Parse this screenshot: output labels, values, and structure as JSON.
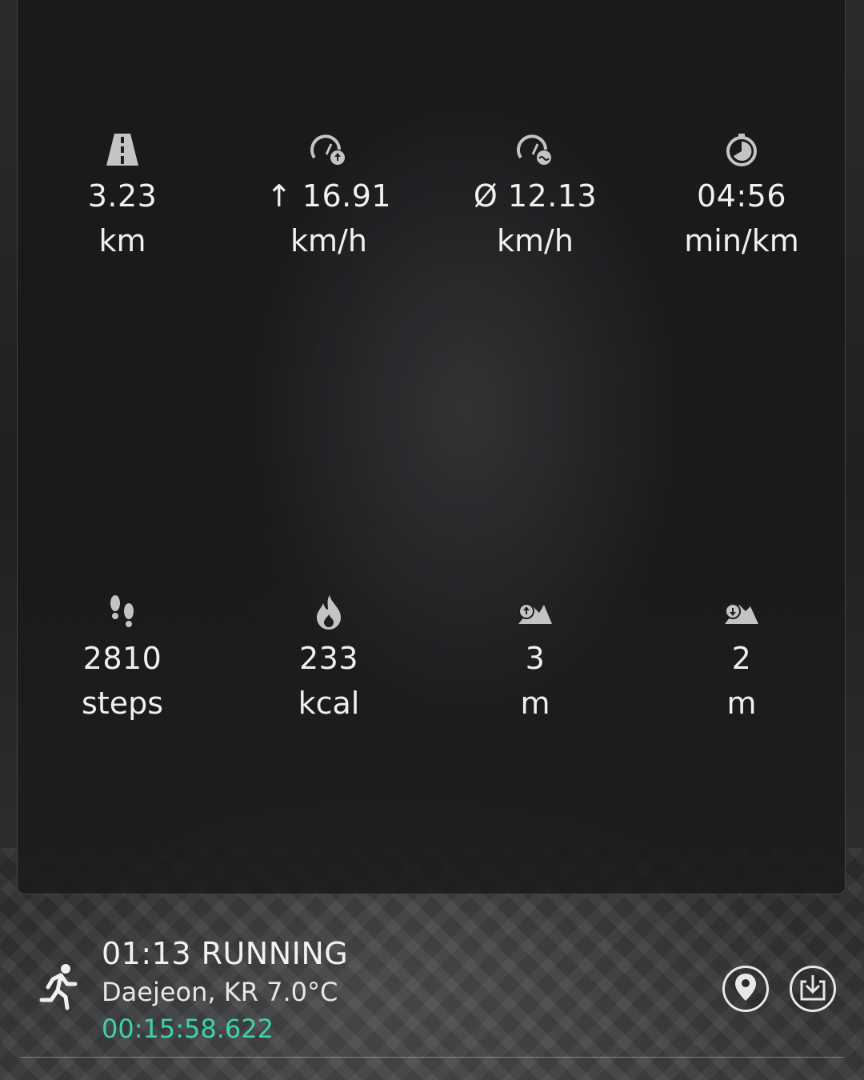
{
  "stats_top": [
    {
      "icon": "road-icon",
      "value": "3.23",
      "unit": "km"
    },
    {
      "icon": "max-speed-icon",
      "value": "↑ 16.91",
      "unit": "km/h"
    },
    {
      "icon": "avg-speed-icon",
      "value": "Ø 12.13",
      "unit": "km/h"
    },
    {
      "icon": "pace-timer-icon",
      "value": "04:56",
      "unit": "min/km"
    }
  ],
  "stats_bottom": [
    {
      "icon": "footsteps-icon",
      "value": "2810",
      "unit": "steps"
    },
    {
      "icon": "flame-icon",
      "value": "233",
      "unit": "kcal"
    },
    {
      "icon": "elevation-up-icon",
      "value": "3",
      "unit": "m"
    },
    {
      "icon": "elevation-down-icon",
      "value": "2",
      "unit": "m"
    }
  ],
  "activity": {
    "title": "01:13 RUNNING",
    "location": "Daejeon, KR 7.0°C",
    "duration": "00:15:58.622",
    "icon": "running-person-icon"
  },
  "actions": [
    {
      "icon": "location-pin-icon"
    },
    {
      "icon": "download-icon"
    }
  ],
  "colors": {
    "accent": "#3fd3a6",
    "text": "#f0f0f0",
    "icon": "#c8c8c8"
  }
}
